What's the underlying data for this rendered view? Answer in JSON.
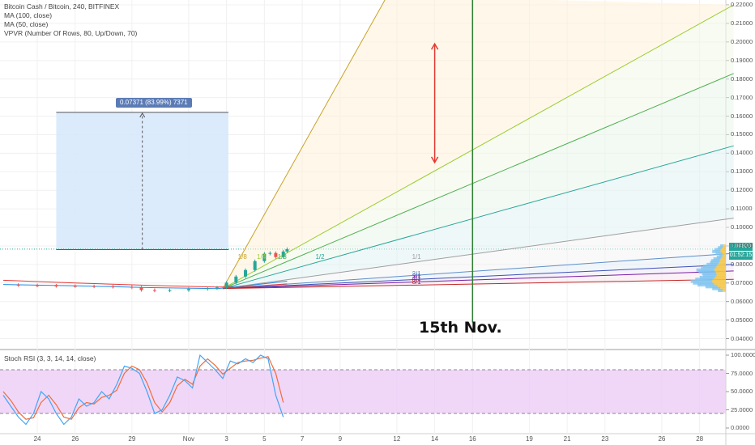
{
  "header": {
    "title": "Bitcoin Cash / Bitcoin, 240, BITFINEX",
    "ma100": "MA (100, close)",
    "ma50": "MA (50, close)",
    "vpvr": "VPVR (Number Of Rows, 80, Up/Down, 70)",
    "stoch": "Stoch RSI (3, 3, 14, 14, close)"
  },
  "measure": {
    "label": "0.07371 (83.99%) 7371"
  },
  "badges": {
    "price": "0.08828",
    "time": "01:52:15"
  },
  "annotation": "15th Nov.",
  "colors": {
    "up_candle": "#26a69a",
    "down_candle": "#ef5350",
    "ma100": "#e53935",
    "ma50": "#1e88e5",
    "stoch_k": "#42a5f5",
    "stoch_d": "#ef6c3a",
    "stoch_band": "#e9c6f5",
    "vertical_line": "#2e7d32",
    "arrow": "#e53935",
    "measure_fill": "#d6e8fb"
  },
  "fan_labels": [
    "1/8",
    "1/4",
    "1/3",
    "1/2",
    "1/1",
    "2/1",
    "3/1",
    "4/1",
    "8/1"
  ],
  "chart_data": [
    {
      "type": "line",
      "title": "Bitcoin Cash / Bitcoin, 240, BITFINEX",
      "ylim": [
        0.03,
        0.225
      ],
      "y_ticks": [
        0.22,
        0.21,
        0.2,
        0.19,
        0.18,
        0.17,
        0.16,
        0.15,
        0.14,
        0.13,
        0.12,
        0.11,
        0.1,
        0.09,
        0.08,
        0.07,
        0.06,
        0.05,
        0.04
      ],
      "y_tick_labels": [
        "0.22000",
        "0.21000",
        "0.20000",
        "0.19000",
        "0.18000",
        "0.17000",
        "0.16000",
        "0.15000",
        "0.14000",
        "0.13000",
        "0.12000",
        "0.11000",
        "0.10000",
        "0.09000",
        "0.08000",
        "0.07000",
        "0.06000",
        "0.05000",
        "0.04000"
      ],
      "x_tick_labels": [
        {
          "label": "24",
          "day": 24
        },
        {
          "label": "26",
          "day": 26
        },
        {
          "label": "29",
          "day": 29
        },
        {
          "label": "Nov",
          "day": 32
        },
        {
          "label": "3",
          "day": 34
        },
        {
          "label": "5",
          "day": 36
        },
        {
          "label": "7",
          "day": 38
        },
        {
          "label": "9",
          "day": 40
        },
        {
          "label": "12",
          "day": 43
        },
        {
          "label": "14",
          "day": 45
        },
        {
          "label": "16",
          "day": 47
        },
        {
          "label": "19",
          "day": 50
        },
        {
          "label": "21",
          "day": 52
        },
        {
          "label": "23",
          "day": 54
        },
        {
          "label": "26",
          "day": 57
        },
        {
          "label": "28",
          "day": 59
        }
      ],
      "price_series": [
        [
          22.2,
          0.069
        ],
        [
          23.0,
          0.0688
        ],
        [
          24.0,
          0.0686
        ],
        [
          25.0,
          0.0684
        ],
        [
          26.0,
          0.0683
        ],
        [
          27.0,
          0.0681
        ],
        [
          28.0,
          0.0679
        ],
        [
          29.0,
          0.0676
        ],
        [
          29.5,
          0.0662
        ],
        [
          30.2,
          0.0659
        ],
        [
          31.0,
          0.0661
        ],
        [
          32.0,
          0.0668
        ],
        [
          33.0,
          0.0672
        ],
        [
          33.5,
          0.0676
        ],
        [
          34.0,
          0.0702
        ],
        [
          34.5,
          0.0735
        ],
        [
          35.0,
          0.077
        ],
        [
          35.5,
          0.0818
        ],
        [
          36.0,
          0.0858
        ],
        [
          36.3,
          0.0862
        ],
        [
          36.6,
          0.084
        ],
        [
          37.0,
          0.087
        ],
        [
          37.2,
          0.0883
        ]
      ],
      "ma100_series": [
        [
          22.2,
          0.0715
        ],
        [
          26.0,
          0.07
        ],
        [
          30.0,
          0.0687
        ],
        [
          33.5,
          0.0678
        ],
        [
          35.0,
          0.068
        ],
        [
          37.2,
          0.0695
        ]
      ],
      "ma50_series": [
        [
          22.2,
          0.0692
        ],
        [
          26.0,
          0.0685
        ],
        [
          30.0,
          0.0675
        ],
        [
          33.5,
          0.067
        ],
        [
          35.0,
          0.0685
        ],
        [
          37.2,
          0.071
        ]
      ],
      "gann_fan": {
        "origin": [
          33.8,
          0.067
        ],
        "lines": [
          {
            "label": "1/8",
            "end": [
              42.5,
              0.225
            ],
            "color": "#c9a227"
          },
          {
            "label": "1/4",
            "end": [
              60.8,
              0.22
            ],
            "color": "#9acd32"
          },
          {
            "label": "1/3",
            "end": [
              60.8,
              0.183
            ],
            "color": "#4caf50"
          },
          {
            "label": "1/2",
            "end": [
              60.8,
              0.144
            ],
            "color": "#26a69a"
          },
          {
            "label": "1/1",
            "end": [
              60.8,
              0.105
            ],
            "color": "#9e9e9e"
          },
          {
            "label": "2/1",
            "end": [
              60.8,
              0.086
            ],
            "color": "#5c8fc9"
          },
          {
            "label": "3/1",
            "end": [
              60.8,
              0.08
            ],
            "color": "#3f51b5"
          },
          {
            "label": "4/1",
            "end": [
              60.8,
              0.0765
            ],
            "color": "#7b1fa2"
          },
          {
            "label": "8/1",
            "end": [
              60.8,
              0.072
            ],
            "color": "#c62828"
          }
        ]
      },
      "measure_box": {
        "x_start": 25.0,
        "x_end": 34.1,
        "y_low": 0.088,
        "y_high": 0.162
      },
      "vertical_line_day": 47.0,
      "arrow": {
        "day": 45.0,
        "y_top": 0.199,
        "y_bottom": 0.135
      },
      "current_price": 0.08828
    },
    {
      "type": "line",
      "title": "Stoch RSI (3, 3, 14, 14, close)",
      "ylim": [
        -5,
        105
      ],
      "y_ticks": [
        100,
        75,
        50,
        25,
        0
      ],
      "y_tick_labels": [
        "100.0000",
        "75.0000",
        "50.0000",
        "25.0000",
        "0.0000"
      ],
      "band": [
        20,
        80
      ],
      "k_series": [
        [
          22.2,
          45
        ],
        [
          22.6,
          30
        ],
        [
          23.0,
          15
        ],
        [
          23.4,
          5
        ],
        [
          23.8,
          20
        ],
        [
          24.2,
          50
        ],
        [
          24.6,
          40
        ],
        [
          25.0,
          20
        ],
        [
          25.4,
          5
        ],
        [
          25.8,
          15
        ],
        [
          26.2,
          40
        ],
        [
          26.6,
          30
        ],
        [
          27.0,
          35
        ],
        [
          27.4,
          50
        ],
        [
          27.8,
          40
        ],
        [
          28.2,
          60
        ],
        [
          28.6,
          85
        ],
        [
          29.0,
          82
        ],
        [
          29.4,
          75
        ],
        [
          29.8,
          50
        ],
        [
          30.2,
          20
        ],
        [
          30.6,
          25
        ],
        [
          31.0,
          45
        ],
        [
          31.4,
          70
        ],
        [
          31.8,
          65
        ],
        [
          32.2,
          55
        ],
        [
          32.6,
          100
        ],
        [
          33.0,
          90
        ],
        [
          33.4,
          80
        ],
        [
          33.8,
          68
        ],
        [
          34.2,
          92
        ],
        [
          34.6,
          88
        ],
        [
          35.0,
          95
        ],
        [
          35.4,
          90
        ],
        [
          35.8,
          100
        ],
        [
          36.2,
          95
        ],
        [
          36.6,
          45
        ],
        [
          37.0,
          15
        ]
      ],
      "d_series": [
        [
          22.2,
          50
        ],
        [
          22.6,
          38
        ],
        [
          23.0,
          22
        ],
        [
          23.4,
          12
        ],
        [
          23.8,
          14
        ],
        [
          24.2,
          35
        ],
        [
          24.6,
          45
        ],
        [
          25.0,
          32
        ],
        [
          25.4,
          15
        ],
        [
          25.8,
          12
        ],
        [
          26.2,
          28
        ],
        [
          26.6,
          35
        ],
        [
          27.0,
          33
        ],
        [
          27.4,
          42
        ],
        [
          27.8,
          45
        ],
        [
          28.2,
          52
        ],
        [
          28.6,
          75
        ],
        [
          29.0,
          85
        ],
        [
          29.4,
          80
        ],
        [
          29.8,
          62
        ],
        [
          30.2,
          35
        ],
        [
          30.6,
          22
        ],
        [
          31.0,
          35
        ],
        [
          31.4,
          58
        ],
        [
          31.8,
          67
        ],
        [
          32.2,
          60
        ],
        [
          32.6,
          85
        ],
        [
          33.0,
          95
        ],
        [
          33.4,
          86
        ],
        [
          33.8,
          74
        ],
        [
          34.2,
          82
        ],
        [
          34.6,
          90
        ],
        [
          35.0,
          92
        ],
        [
          35.4,
          93
        ],
        [
          35.8,
          96
        ],
        [
          36.2,
          98
        ],
        [
          36.6,
          75
        ],
        [
          37.0,
          35
        ]
      ]
    }
  ]
}
